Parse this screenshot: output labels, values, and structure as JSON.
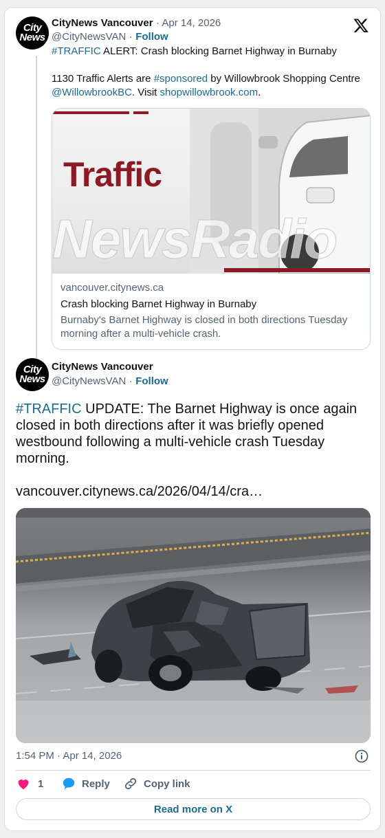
{
  "tweet1": {
    "display_name": "CityNews Vancouver",
    "date": "· Apr 14, 2026",
    "handle": "@CityNewsVAN",
    "dot": "·",
    "follow": "Follow",
    "hashtag": "#TRAFFIC",
    "line1_rest": " ALERT: Crash blocking Barnet Highway in Burnaby",
    "line2_a": "1130 Traffic Alerts are ",
    "line2_tag": "#sponsored",
    "line2_b": " by Willowbrook Shopping Centre",
    "line3_mention": "@WillowbrookBC",
    "line3_mid": ". Visit ",
    "line3_url": "shopwillowbrook.com",
    "line3_end": ".",
    "card": {
      "image_title": "Traffic",
      "image_watermark": "NewsRadio",
      "domain": "vancouver.citynews.ca",
      "headline": "Crash blocking Barnet Highway in Burnaby",
      "description_line1": "Burnaby's Barnet Highway is closed in both directions Tuesday",
      "description_line2": "morning after a multi-vehicle crash."
    }
  },
  "tweet2": {
    "display_name": "CityNews Vancouver",
    "handle": "@CityNewsVAN",
    "dot": "·",
    "follow": "Follow",
    "hashtag": "#TRAFFIC",
    "text_line1_rest": " UPDATE: The Barnet Highway is once again",
    "text_line2": "closed in both directions after it was briefly opened",
    "text_line3": "westbound following a multi-vehicle crash Tuesday",
    "text_line4": "morning.",
    "url": "vancouver.citynews.ca/2026/04/14/cra…",
    "timestamp": "1:54 PM · Apr 14, 2026",
    "likes": "1",
    "reply": "Reply",
    "copy_link": "Copy link",
    "read_more": "Read more on X"
  },
  "avatar": {
    "line1": "City",
    "line2": "News"
  },
  "colors": {
    "link": "#1d6b8c",
    "like": "#f91880",
    "reply": "#1d9bf0",
    "traffic_red": "#8c1a24"
  }
}
